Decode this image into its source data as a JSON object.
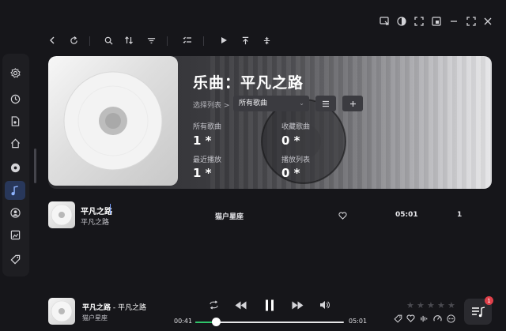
{
  "header": {
    "title": "乐曲：平凡之路",
    "select_label": "选择列表 >",
    "select_value": "所有歌曲",
    "stats": [
      {
        "label": "所有歌曲",
        "value": "1 *"
      },
      {
        "label": "收藏歌曲",
        "value": "0 *"
      },
      {
        "label": "最近播放",
        "value": "1 *"
      },
      {
        "label": "播放列表",
        "value": "0 *"
      }
    ]
  },
  "song_row": {
    "title": "平凡之路",
    "subtitle": "平凡之路",
    "artist": "猫户星座",
    "duration": "05:01",
    "count": "1"
  },
  "player": {
    "title": "平凡之路",
    "separator_album": " - 平凡之路",
    "artist": "猫户星座",
    "elapsed": "00:41",
    "total": "05:01",
    "progress": 0.136,
    "rating": 0,
    "rating_max": 5,
    "queue_badge": "1"
  },
  "colors": {
    "background": "#16161a",
    "accent_progress": "#2fc56a",
    "badge": "#e0404a",
    "active_sidebar": "#28375a"
  },
  "icons": {
    "window": [
      "fullscreen-icon",
      "theme-icon",
      "mini-mode-icon",
      "pip-icon",
      "minimize-icon",
      "maximize-icon",
      "close-icon"
    ],
    "toolbar": [
      "back-icon",
      "refresh-icon",
      "search-icon",
      "sort-icon",
      "filter-icon",
      "multi-select-icon",
      "play-icon",
      "scroll-top-icon",
      "locate-icon"
    ],
    "sidebar": [
      "settings-icon",
      "recent-icon",
      "file-icon",
      "home-icon",
      "disc-icon",
      "music-icon",
      "user-icon",
      "gallery-icon",
      "tag-icon"
    ],
    "player": [
      "repeat-icon",
      "previous-icon",
      "pause-icon",
      "next-icon",
      "volume-icon",
      "tag-icon",
      "heart-icon",
      "equalizer-icon",
      "speed-icon",
      "more-icon"
    ]
  }
}
